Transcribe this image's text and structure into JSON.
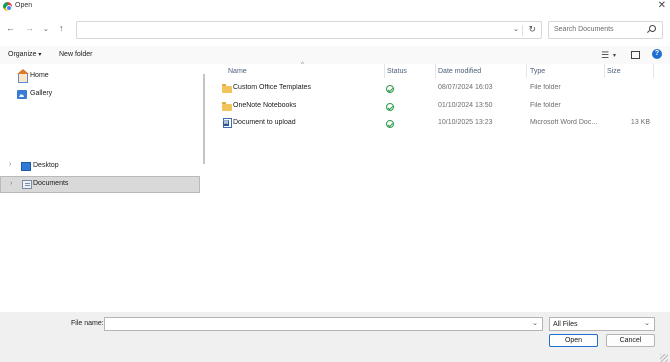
{
  "window": {
    "title": "Open"
  },
  "nav": {
    "address_value": "",
    "search_placeholder": "Search Documents"
  },
  "commands": {
    "organize_label": "Organize",
    "new_folder_label": "New folder"
  },
  "sidebar": {
    "items": [
      {
        "label": "Home",
        "icon": "home-icon"
      },
      {
        "label": "Gallery",
        "icon": "gallery-icon"
      },
      {
        "label": "Desktop",
        "icon": "desktop-icon"
      },
      {
        "label": "Documents",
        "icon": "documents-icon",
        "selected": true
      }
    ]
  },
  "files": {
    "columns": {
      "name": "Name",
      "status": "Status",
      "date": "Date modified",
      "type": "Type",
      "size": "Size"
    },
    "rows": [
      {
        "name": "Custom Office Templates",
        "date": "08/07/2024 16:03",
        "type": "File folder",
        "size": "",
        "icon": "folder-icon",
        "status": "synced"
      },
      {
        "name": "OneNote Notebooks",
        "date": "01/10/2024 13:50",
        "type": "File folder",
        "size": "",
        "icon": "folder-icon",
        "status": "synced"
      },
      {
        "name": "Document to upload",
        "date": "10/10/2025 13:23",
        "type": "Microsoft Word Doc...",
        "size": "13 KB",
        "icon": "word-doc-icon",
        "status": "synced"
      }
    ]
  },
  "footer": {
    "filename_label": "File name:",
    "filename_value": "",
    "filetype_value": "All Files",
    "open_label": "Open",
    "cancel_label": "Cancel"
  },
  "colors": {
    "accent": "#1f6fd1",
    "status_ok": "#2e9a4a",
    "folder": "#f0c35b"
  }
}
